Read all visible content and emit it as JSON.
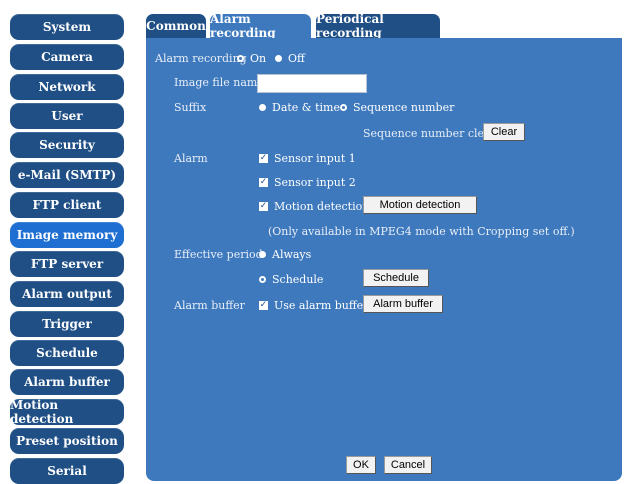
{
  "sidebar": {
    "items": [
      {
        "label": "System"
      },
      {
        "label": "Camera"
      },
      {
        "label": "Network"
      },
      {
        "label": "User"
      },
      {
        "label": "Security"
      },
      {
        "label": "e-Mail (SMTP)"
      },
      {
        "label": "FTP client"
      },
      {
        "label": "Image memory"
      },
      {
        "label": "FTP server"
      },
      {
        "label": "Alarm output"
      },
      {
        "label": "Trigger"
      },
      {
        "label": "Schedule"
      },
      {
        "label": "Alarm buffer"
      },
      {
        "label": "Motion detection"
      },
      {
        "label": "Preset position"
      },
      {
        "label": "Serial"
      }
    ],
    "active": "Image memory"
  },
  "tabs": [
    {
      "label": "Common"
    },
    {
      "label": "Alarm recording"
    },
    {
      "label": "Periodical recording"
    }
  ],
  "form": {
    "alarm_recording": {
      "label": "Alarm recording",
      "on": "On",
      "off": "Off",
      "selected": "On"
    },
    "image_file_name": {
      "label": "Image file name",
      "value": ""
    },
    "suffix": {
      "label": "Suffix",
      "date_time": "Date & time",
      "sequence": "Sequence number",
      "selected": "Sequence number"
    },
    "sequence_clear": {
      "label": "Sequence number clear",
      "button": "Clear"
    },
    "alarm": {
      "label": "Alarm",
      "sensor1": "Sensor input 1",
      "sensor2": "Sensor input 2",
      "motion": "Motion detection",
      "motion_button": "Motion detection",
      "note": "(Only available in MPEG4 mode with Cropping set off.)"
    },
    "effective_period": {
      "label": "Effective period",
      "always": "Always",
      "schedule": "Schedule",
      "schedule_button": "Schedule",
      "selected": "Schedule"
    },
    "alarm_buffer": {
      "label": "Alarm buffer",
      "use": "Use alarm buffer",
      "button": "Alarm buffer"
    }
  },
  "footer": {
    "ok": "OK",
    "cancel": "Cancel"
  },
  "colors": {
    "sidebar_button": "#1f4f84",
    "sidebar_active": "#1f6fd2",
    "panel": "#3e79bd"
  }
}
